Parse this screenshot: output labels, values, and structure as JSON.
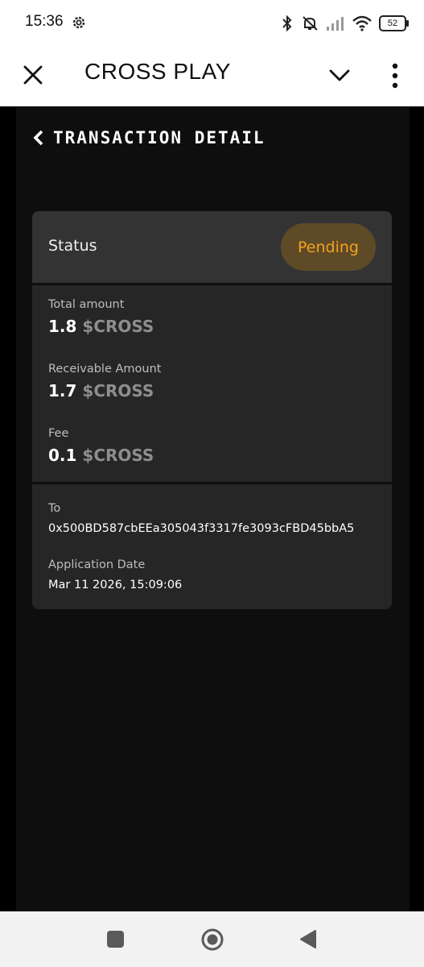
{
  "status_bar": {
    "time": "15:36",
    "battery": "52",
    "icons": [
      "settings-gear-icon",
      "bluetooth-icon",
      "mute-icon",
      "signal-icon",
      "wifi-icon",
      "battery-icon"
    ]
  },
  "app_bar": {
    "title": "CROSS PLAY",
    "icons": [
      "close-icon",
      "chevron-down-icon",
      "more-vertical-icon"
    ]
  },
  "page": {
    "title": "TRANSACTION DETAIL",
    "back_icon": "back-chevron-icon"
  },
  "status": {
    "label": "Status",
    "value": "Pending",
    "value_color": "#f3a122"
  },
  "amounts": [
    {
      "label": "Total amount",
      "value": "1.8",
      "currency": "$CROSS"
    },
    {
      "label": "Receivable Amount",
      "value": "1.7",
      "currency": "$CROSS"
    },
    {
      "label": "Fee",
      "value": "0.1",
      "currency": "$CROSS"
    }
  ],
  "details": [
    {
      "label": "To",
      "value": "0x500BD587cbEEa305043f3317fe3093cFBD45bbA5"
    },
    {
      "label": "Application Date",
      "value": "Mar 11 2026, 15:09:06"
    }
  ],
  "nav_bar": {
    "icons": [
      "recents-square-icon",
      "home-circle-icon",
      "back-triangle-icon"
    ]
  }
}
